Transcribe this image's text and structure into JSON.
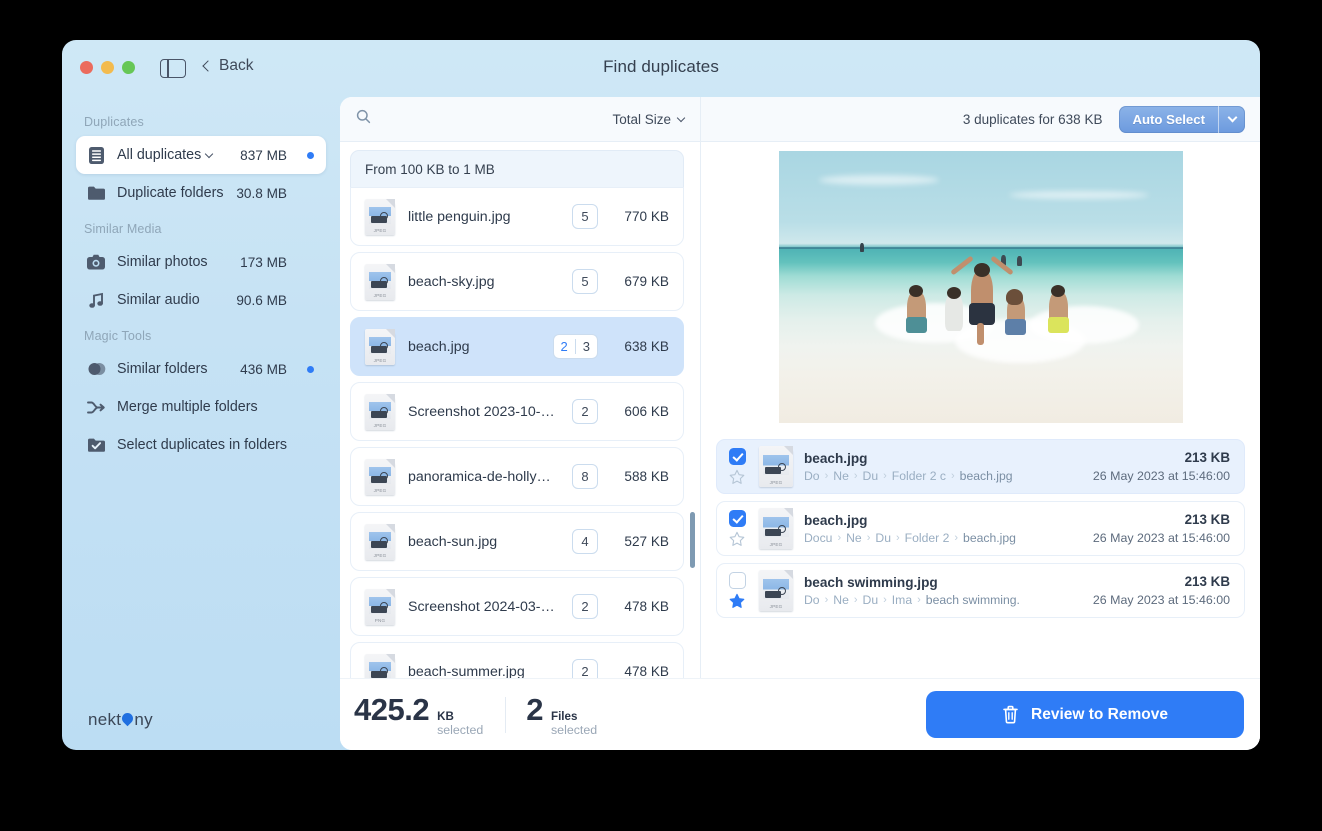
{
  "window": {
    "title": "Find duplicates",
    "back_label": "Back",
    "traffic_lights": [
      "close-button",
      "minimize-button",
      "maximize-button"
    ]
  },
  "sidebar": {
    "sections": [
      {
        "header": "Duplicates",
        "items": [
          {
            "label": "All duplicates",
            "value": "837 MB",
            "icon": "list-icon",
            "active": true,
            "caret": true,
            "dot": true
          },
          {
            "label": "Duplicate folders",
            "value": "30.8 MB",
            "icon": "folder-icon",
            "active": false,
            "caret": false,
            "dot": false
          }
        ]
      },
      {
        "header": "Similar Media",
        "items": [
          {
            "label": "Similar photos",
            "value": "173 MB",
            "icon": "camera-icon",
            "active": false,
            "caret": false,
            "dot": false
          },
          {
            "label": "Similar audio",
            "value": "90.6 MB",
            "icon": "music-note-icon",
            "active": false,
            "caret": false,
            "dot": false
          }
        ]
      },
      {
        "header": "Magic Tools",
        "items": [
          {
            "label": "Similar folders",
            "value": "436 MB",
            "icon": "similar-folders-icon",
            "active": false,
            "caret": false,
            "dot": true
          },
          {
            "label": "Merge multiple folders",
            "value": "",
            "icon": "merge-icon",
            "active": false,
            "caret": false,
            "dot": false
          },
          {
            "label": "Select duplicates in folders",
            "value": "",
            "icon": "checked-folder-icon",
            "active": false,
            "caret": false,
            "dot": false
          }
        ]
      }
    ],
    "logo": {
      "pre": "nekt",
      "post": "ny"
    }
  },
  "list_pane": {
    "search_placeholder": "",
    "search_value": "",
    "sort_label": "Total Size",
    "group_label": "From 100 KB to 1 MB",
    "files": [
      {
        "name": "little penguin.jpg",
        "count": "5",
        "count_selected": "",
        "size": "770 KB",
        "type": "JPEG",
        "selected": false
      },
      {
        "name": "beach-sky.jpg",
        "count": "5",
        "count_selected": "",
        "size": "679 KB",
        "type": "JPEG",
        "selected": false
      },
      {
        "name": "beach.jpg",
        "count": "3",
        "count_selected": "2",
        "size": "638 KB",
        "type": "JPEG",
        "selected": true
      },
      {
        "name": "Screenshot 2023-10-30...",
        "count": "2",
        "count_selected": "",
        "size": "606 KB",
        "type": "JPEG",
        "selected": false
      },
      {
        "name": "panoramica-de-hollywo...",
        "count": "8",
        "count_selected": "",
        "size": "588 KB",
        "type": "JPEG",
        "selected": false
      },
      {
        "name": "beach-sun.jpg",
        "count": "4",
        "count_selected": "",
        "size": "527 KB",
        "type": "JPEG",
        "selected": false
      },
      {
        "name": "Screenshot 2024-03-2...",
        "count": "2",
        "count_selected": "",
        "size": "478 KB",
        "type": "PNG",
        "selected": false
      },
      {
        "name": "beach-summer.jpg",
        "count": "2",
        "count_selected": "",
        "size": "478 KB",
        "type": "JPEG",
        "selected": false
      }
    ]
  },
  "detail_pane": {
    "summary": "3 duplicates for 638 KB",
    "auto_select_label": "Auto Select",
    "preview_alt": "beach photo of people running into the sea",
    "duplicates": [
      {
        "name": "beach.jpg",
        "size": "213 KB",
        "date": "26 May 2023 at 15:46:00",
        "checked": true,
        "starred": false,
        "row_selected": true,
        "type": "JPEG",
        "path": [
          "Do",
          "Ne",
          "Du",
          "Folder 2 c",
          "beach.jpg"
        ]
      },
      {
        "name": "beach.jpg",
        "size": "213 KB",
        "date": "26 May 2023 at 15:46:00",
        "checked": true,
        "starred": false,
        "row_selected": false,
        "type": "JPEG",
        "path": [
          "Docu",
          "Ne",
          "Du",
          "Folder 2",
          "beach.jpg"
        ]
      },
      {
        "name": "beach swimming.jpg",
        "size": "213 KB",
        "date": "26 May 2023 at 15:46:00",
        "checked": false,
        "starred": true,
        "row_selected": false,
        "type": "JPEG",
        "path": [
          "Do",
          "Ne",
          "Du",
          "Ima",
          "beach swimming."
        ]
      }
    ]
  },
  "bottom_bar": {
    "size_number": "425.2",
    "size_unit": "KB",
    "size_sub": "selected",
    "files_number": "2",
    "files_unit": "Files",
    "files_sub": "selected",
    "remove_label": "Review to Remove"
  },
  "colors": {
    "accent": "#2f7cf6",
    "sidebar_bg": "#bcddf3",
    "selected_row": "#cfe3fa",
    "star_active": "#2f7cf6",
    "badge_blue": "#2f7cf6"
  }
}
